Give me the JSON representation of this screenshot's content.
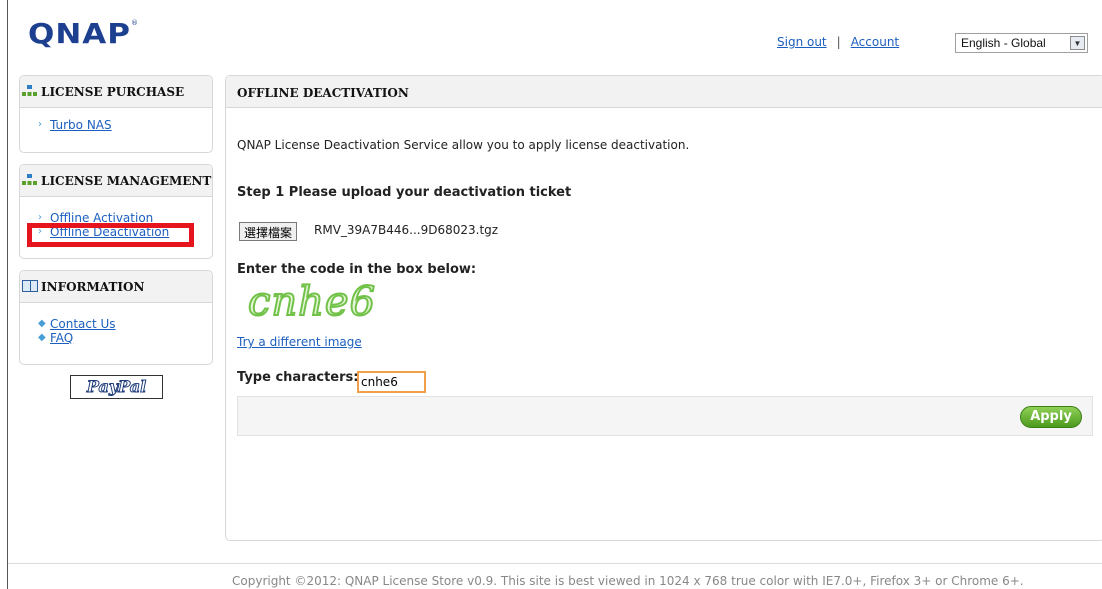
{
  "header": {
    "logo": "QNAP",
    "sign_out": "Sign out",
    "separator": "|",
    "account": "Account",
    "language": "English - Global"
  },
  "sidebar": {
    "purchase": {
      "title": "LICENSE PURCHASE",
      "items": [
        {
          "label": "Turbo NAS"
        }
      ]
    },
    "management": {
      "title": "LICENSE MANAGEMENT",
      "items": [
        {
          "label": "Offline Activation"
        },
        {
          "label": "Offline Deactivation"
        }
      ]
    },
    "information": {
      "title": "INFORMATION",
      "items": [
        {
          "label": "Contact Us"
        },
        {
          "label": "FAQ"
        }
      ]
    },
    "paypal": "PayPal"
  },
  "main": {
    "title": "OFFLINE DEACTIVATION",
    "intro": "QNAP License Deactivation Service allow you to apply license deactivation.",
    "step1": "Step 1 Please upload your deactivation ticket",
    "file_button": "選擇檔案",
    "file_name": "RMV_39A7B446...9D68023.tgz",
    "enter_code": "Enter the code in the box below:",
    "captcha": "cnhe6",
    "try_different": "Try a different image",
    "type_label": "Type characters:",
    "type_value": "cnhe6",
    "apply": "Apply"
  },
  "footer": "Copyright ©2012: QNAP License Store v0.9. This site is best viewed in 1024 x 768 true color with IE7.0+, Firefox 3+ or Chrome 6+.",
  "colors": {
    "brand": "#1d3f90",
    "link": "#1d5fbf",
    "apply": "#5aa82a",
    "highlight": "#e5141d"
  }
}
